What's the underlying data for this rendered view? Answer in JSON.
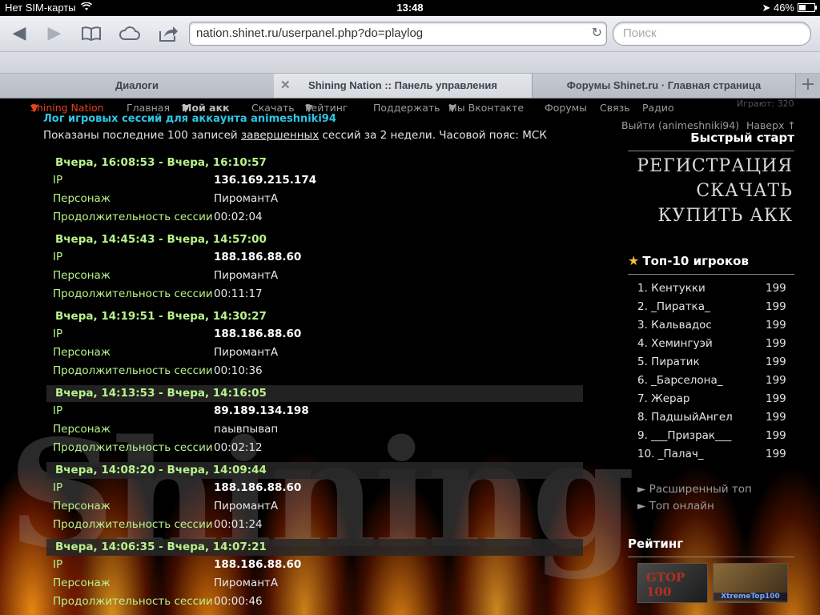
{
  "status": {
    "carrier": "Нет SIM-карты",
    "time": "13:48",
    "battery": "46%",
    "battery_level": 0.46
  },
  "browser": {
    "url": "nation.shinet.ru/userpanel.php?do=playlog",
    "search_placeholder": "Поиск",
    "tabs": [
      {
        "label": "Диалоги",
        "active": false
      },
      {
        "label": "Shining Nation :: Панель управления",
        "active": true
      },
      {
        "label": "Форумы Shinet.ru · Главная страница",
        "active": false
      }
    ]
  },
  "nav": {
    "brand": "Shining Nation",
    "items": [
      "Главная",
      "Мой акк",
      "Скачать",
      "Рейтинг",
      "Поддержать",
      "Мы Вконтакте",
      "Форумы",
      "Связь",
      "Радио"
    ],
    "logout": "Выйти (animeshniki94)",
    "up": "Наверх ↑",
    "ghost": "Играют: 320"
  },
  "log": {
    "title": "Лог игровых сессий для аккаунта animeshniki94",
    "info_prefix": "Показаны последние 100 записей ",
    "info_link": "завершенных",
    "info_suffix": " сессий за 2 недели. Часовой пояс: МСК",
    "labels": {
      "ip": "IP",
      "character": "Персонаж",
      "duration": "Продолжительность сессии"
    },
    "sessions": [
      {
        "range": "Вчера, 16:08:53   -   Вчера, 16:10:57",
        "ip": "136.169.215.174",
        "character": "ПиромантА",
        "duration": "00:02:04"
      },
      {
        "range": "Вчера, 14:45:43   -   Вчера, 14:57:00",
        "ip": "188.186.88.60",
        "character": "ПиромантА",
        "duration": "00:11:17"
      },
      {
        "range": "Вчера, 14:19:51   -   Вчера, 14:30:27",
        "ip": "188.186.88.60",
        "character": "ПиромантА",
        "duration": "00:10:36"
      },
      {
        "range": "Вчера, 14:13:53   -   Вчера, 14:16:05",
        "ip": "89.189.134.198",
        "character": "паывпывап",
        "duration": "00:02:12"
      },
      {
        "range": "Вчера, 14:08:20   -   Вчера, 14:09:44",
        "ip": "188.186.88.60",
        "character": "ПиромантА",
        "duration": "00:01:24"
      },
      {
        "range": "Вчера, 14:06:35   -   Вчера, 14:07:21",
        "ip": "188.186.88.60",
        "character": "ПиромантА",
        "duration": "00:00:46"
      }
    ]
  },
  "quickstart": {
    "title": "Быстрый старт",
    "links": [
      "Регистрация",
      "Скачать",
      "Купить акк"
    ]
  },
  "top10": {
    "title": "Топ-10 игроков",
    "players": [
      {
        "name": "1. Кентукки",
        "score": "199"
      },
      {
        "name": "2. _Пиратка_",
        "score": "199"
      },
      {
        "name": "3. Кальвадос",
        "score": "199"
      },
      {
        "name": "4. Хемингуэй",
        "score": "199"
      },
      {
        "name": "5. Пиратик",
        "score": "199"
      },
      {
        "name": "6. _Барселона_",
        "score": "199"
      },
      {
        "name": "7. Жерар",
        "score": "199"
      },
      {
        "name": "8. ПадшыйАнгел",
        "score": "199"
      },
      {
        "name": "9. ___Призрак___",
        "score": "199"
      },
      {
        "name": "10. _Палач_",
        "score": "199"
      }
    ],
    "more": [
      "► Расширенный топ",
      "► Топ онлайн"
    ]
  },
  "rating": {
    "title": "Рейтинг",
    "badges": [
      "GTOP 100",
      "XtremeTop100"
    ]
  },
  "watermark": "Shining"
}
